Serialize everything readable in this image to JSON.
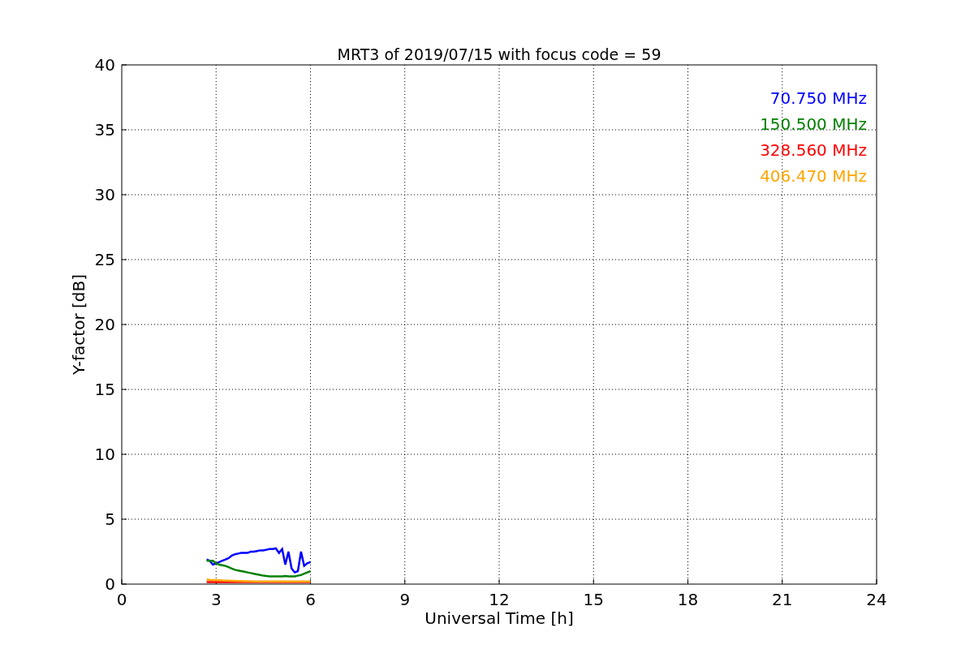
{
  "figure": {
    "chart_data": {
      "type": "line",
      "title": "MRT3 of 2019/07/15 with focus code = 59",
      "xlabel": "Universal Time [h]",
      "ylabel": "Y-factor [dB]",
      "x": [
        2.7,
        2.8,
        2.9,
        3.0,
        3.1,
        3.2,
        3.3,
        3.4,
        3.5,
        3.6,
        3.7,
        3.8,
        3.9,
        4.0,
        4.1,
        4.2,
        4.3,
        4.4,
        4.5,
        4.6,
        4.7,
        4.8,
        4.9,
        5.0,
        5.1,
        5.2,
        5.3,
        5.4,
        5.5,
        5.6,
        5.7,
        5.8,
        5.9,
        6.0
      ],
      "series": [
        {
          "name": "70.750 MHz",
          "color": "#0000ff",
          "values": [
            1.9,
            1.8,
            1.5,
            1.6,
            1.7,
            1.8,
            1.9,
            2.0,
            2.2,
            2.3,
            2.35,
            2.4,
            2.4,
            2.4,
            2.5,
            2.5,
            2.55,
            2.6,
            2.6,
            2.65,
            2.7,
            2.7,
            2.75,
            2.4,
            2.7,
            1.5,
            2.5,
            1.2,
            0.9,
            1.0,
            2.5,
            1.4,
            1.6,
            1.7
          ]
        },
        {
          "name": "150.500 MHz",
          "color": "#008000",
          "values": [
            1.8,
            1.8,
            1.8,
            1.6,
            1.5,
            1.45,
            1.4,
            1.3,
            1.2,
            1.1,
            1.05,
            1.0,
            0.95,
            0.9,
            0.85,
            0.8,
            0.75,
            0.7,
            0.65,
            0.62,
            0.6,
            0.6,
            0.6,
            0.6,
            0.6,
            0.62,
            0.6,
            0.6,
            0.6,
            0.65,
            0.7,
            0.8,
            0.9,
            1.0
          ]
        },
        {
          "name": "328.560 MHz",
          "color": "#ff0000",
          "values": [
            0.15,
            0.15,
            0.15,
            0.15,
            0.15,
            0.15,
            0.15,
            0.15,
            0.15,
            0.15,
            0.15,
            0.15,
            0.15,
            0.15,
            0.15,
            0.15,
            0.15,
            0.15,
            0.15,
            0.15,
            0.15,
            0.15,
            0.15,
            0.15,
            0.15,
            0.15,
            0.15,
            0.15,
            0.15,
            0.15,
            0.15,
            0.15,
            0.15,
            0.15
          ]
        },
        {
          "name": "406.470 MHz",
          "color": "#ffa500",
          "values": [
            0.35,
            0.33,
            0.32,
            0.3,
            0.3,
            0.28,
            0.27,
            0.26,
            0.25,
            0.25,
            0.24,
            0.23,
            0.22,
            0.22,
            0.22,
            0.21,
            0.21,
            0.2,
            0.2,
            0.2,
            0.2,
            0.2,
            0.2,
            0.2,
            0.2,
            0.2,
            0.2,
            0.2,
            0.2,
            0.2,
            0.2,
            0.2,
            0.2,
            0.2
          ]
        }
      ],
      "xlim": [
        0,
        24
      ],
      "ylim": [
        0,
        40
      ],
      "xticks": [
        0,
        3,
        6,
        9,
        12,
        15,
        18,
        21,
        24
      ],
      "yticks": [
        0,
        5,
        10,
        15,
        20,
        25,
        30,
        35,
        40
      ],
      "grid": true
    }
  }
}
